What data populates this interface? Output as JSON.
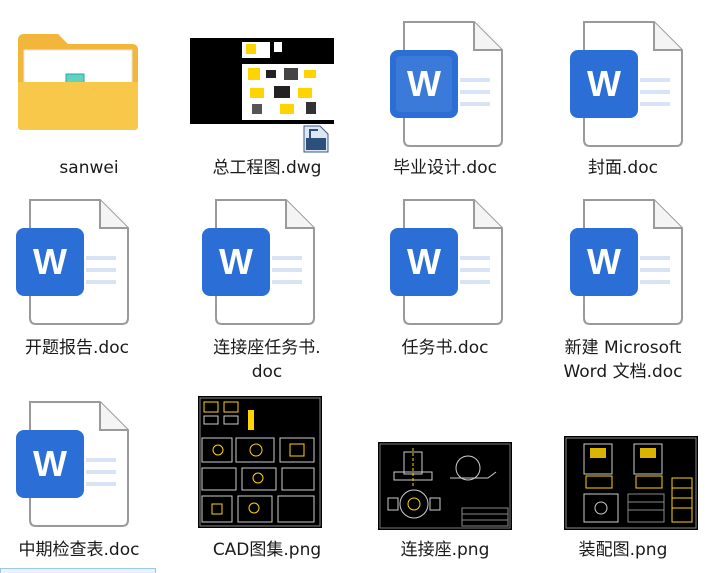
{
  "files": [
    {
      "name": "sanwei",
      "type": "folder",
      "icon": "folder-icon"
    },
    {
      "name": "总工程图.dwg",
      "type": "dwg",
      "icon": "dwg-thumbnail"
    },
    {
      "name": "毕业设计.doc",
      "type": "doc",
      "icon": "word-doc-icon"
    },
    {
      "name": "封面.doc",
      "type": "doc",
      "icon": "word-doc-icon"
    },
    {
      "name": "开题报告.doc",
      "type": "doc",
      "icon": "word-doc-icon"
    },
    {
      "name": "连接座任务书.\ndoc",
      "type": "doc",
      "icon": "word-doc-icon"
    },
    {
      "name": "任务书.doc",
      "type": "doc",
      "icon": "word-doc-icon"
    },
    {
      "name": "新建 Microsoft\nWord 文档.doc",
      "type": "doc",
      "icon": "word-doc-icon"
    },
    {
      "name": "中期检查表.doc",
      "type": "doc",
      "icon": "word-doc-icon"
    },
    {
      "name": "CAD图集.png",
      "type": "png",
      "icon": "cad-drawing-thumbnail"
    },
    {
      "name": "连接座.png",
      "type": "png",
      "icon": "cad-drawing-thumbnail"
    },
    {
      "name": "装配图.png",
      "type": "png",
      "icon": "cad-drawing-thumbnail"
    }
  ],
  "word_icon_letter": "W",
  "colors": {
    "word_blue": "#2b6fd6",
    "folder_yellow": "#f6c342",
    "page_border": "#9a9a9a"
  }
}
